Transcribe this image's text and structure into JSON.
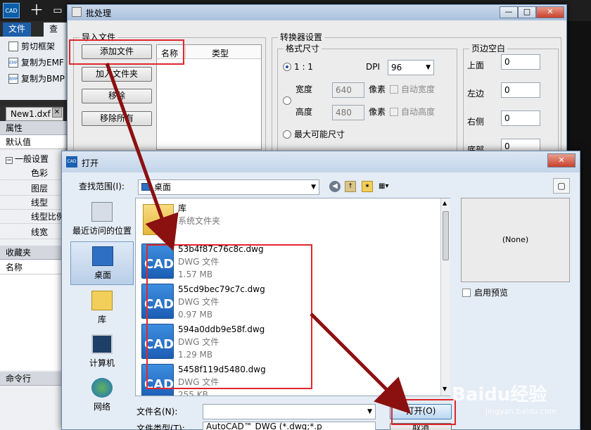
{
  "app": {
    "logo_text": "CAD",
    "tabs": [
      "文件",
      "查看"
    ],
    "ribbon_items": [
      "剪切框架",
      "复制为EMF",
      "复制为BMP"
    ],
    "ribbon_icon_text": [
      "",
      "EMF",
      "BMP"
    ],
    "doc_tab": "New1.dxf",
    "doc_close": "✕",
    "properties": {
      "header": "属性",
      "default": "默认值",
      "general": "一般设置",
      "rows": [
        "色彩",
        "图层",
        "线型",
        "线型比例",
        "线宽"
      ]
    },
    "favorites": {
      "header": "收藏夹",
      "name_col": "名称"
    },
    "command_line": "命令行"
  },
  "batch": {
    "title": "批处理",
    "win_buttons": {
      "minimize": "—",
      "maximize": "□",
      "close": "✕"
    },
    "import_group": "导入文件",
    "buttons": {
      "add": "添加文件",
      "add_folder": "加入文件夹",
      "remove": "移除",
      "remove_all": "移除所有"
    },
    "list_headers": {
      "name": "名称",
      "type": "类型"
    },
    "converter_group": "转换器设置",
    "format_group": "格式尺寸",
    "ratio_label": "1 : 1",
    "dpi_label": "DPI",
    "dpi_value": "96",
    "width_label": "宽度",
    "width_value": "640",
    "height_label": "高度",
    "height_value": "480",
    "pixel_label": "像素",
    "auto_width": "自动宽度",
    "auto_height": "自动高度",
    "max_size": "最大可能尺寸",
    "margin_group": "页边空白",
    "margins": [
      {
        "label": "上面",
        "value": "0"
      },
      {
        "label": "左边",
        "value": "0"
      },
      {
        "label": "右侧",
        "value": "0"
      },
      {
        "label": "底部",
        "value": "0"
      }
    ]
  },
  "open": {
    "title": "打开",
    "title_icon": "CAD",
    "lookin_label": "查找范围(I):",
    "lookin_value": "桌面",
    "places": [
      "最近访问的位置",
      "桌面",
      "库",
      "计算机",
      "网络"
    ],
    "files": [
      {
        "name": "库",
        "type": "系统文件夹",
        "size": ""
      },
      {
        "name": "53b4f87c76c8c.dwg",
        "type": "DWG 文件",
        "size": "1.57 MB"
      },
      {
        "name": "55cd9bec79c7c.dwg",
        "type": "DWG 文件",
        "size": "0.97 MB"
      },
      {
        "name": "594a0ddb9e58f.dwg",
        "type": "DWG 文件",
        "size": "1.29 MB"
      },
      {
        "name": "5458f119d5480.dwg",
        "type": "DWG 文件",
        "size": "255 KB"
      }
    ],
    "file_icon_text": "CAD",
    "preview_text": "(None)",
    "enable_preview": "启用预览",
    "filename_label": "文件名(N):",
    "filename_value": "",
    "filetype_label": "文件类型(T):",
    "filetype_value": "AutoCAD™ DWG (*.dwg;*.p",
    "open_button": "打开(O)",
    "cancel_button": "取消"
  },
  "watermark": {
    "brand": "Baidu经验",
    "url": "jingyan.baidu.com"
  },
  "colors": {
    "highlight_box": "#e1262d",
    "arrow": "#8b1010"
  }
}
